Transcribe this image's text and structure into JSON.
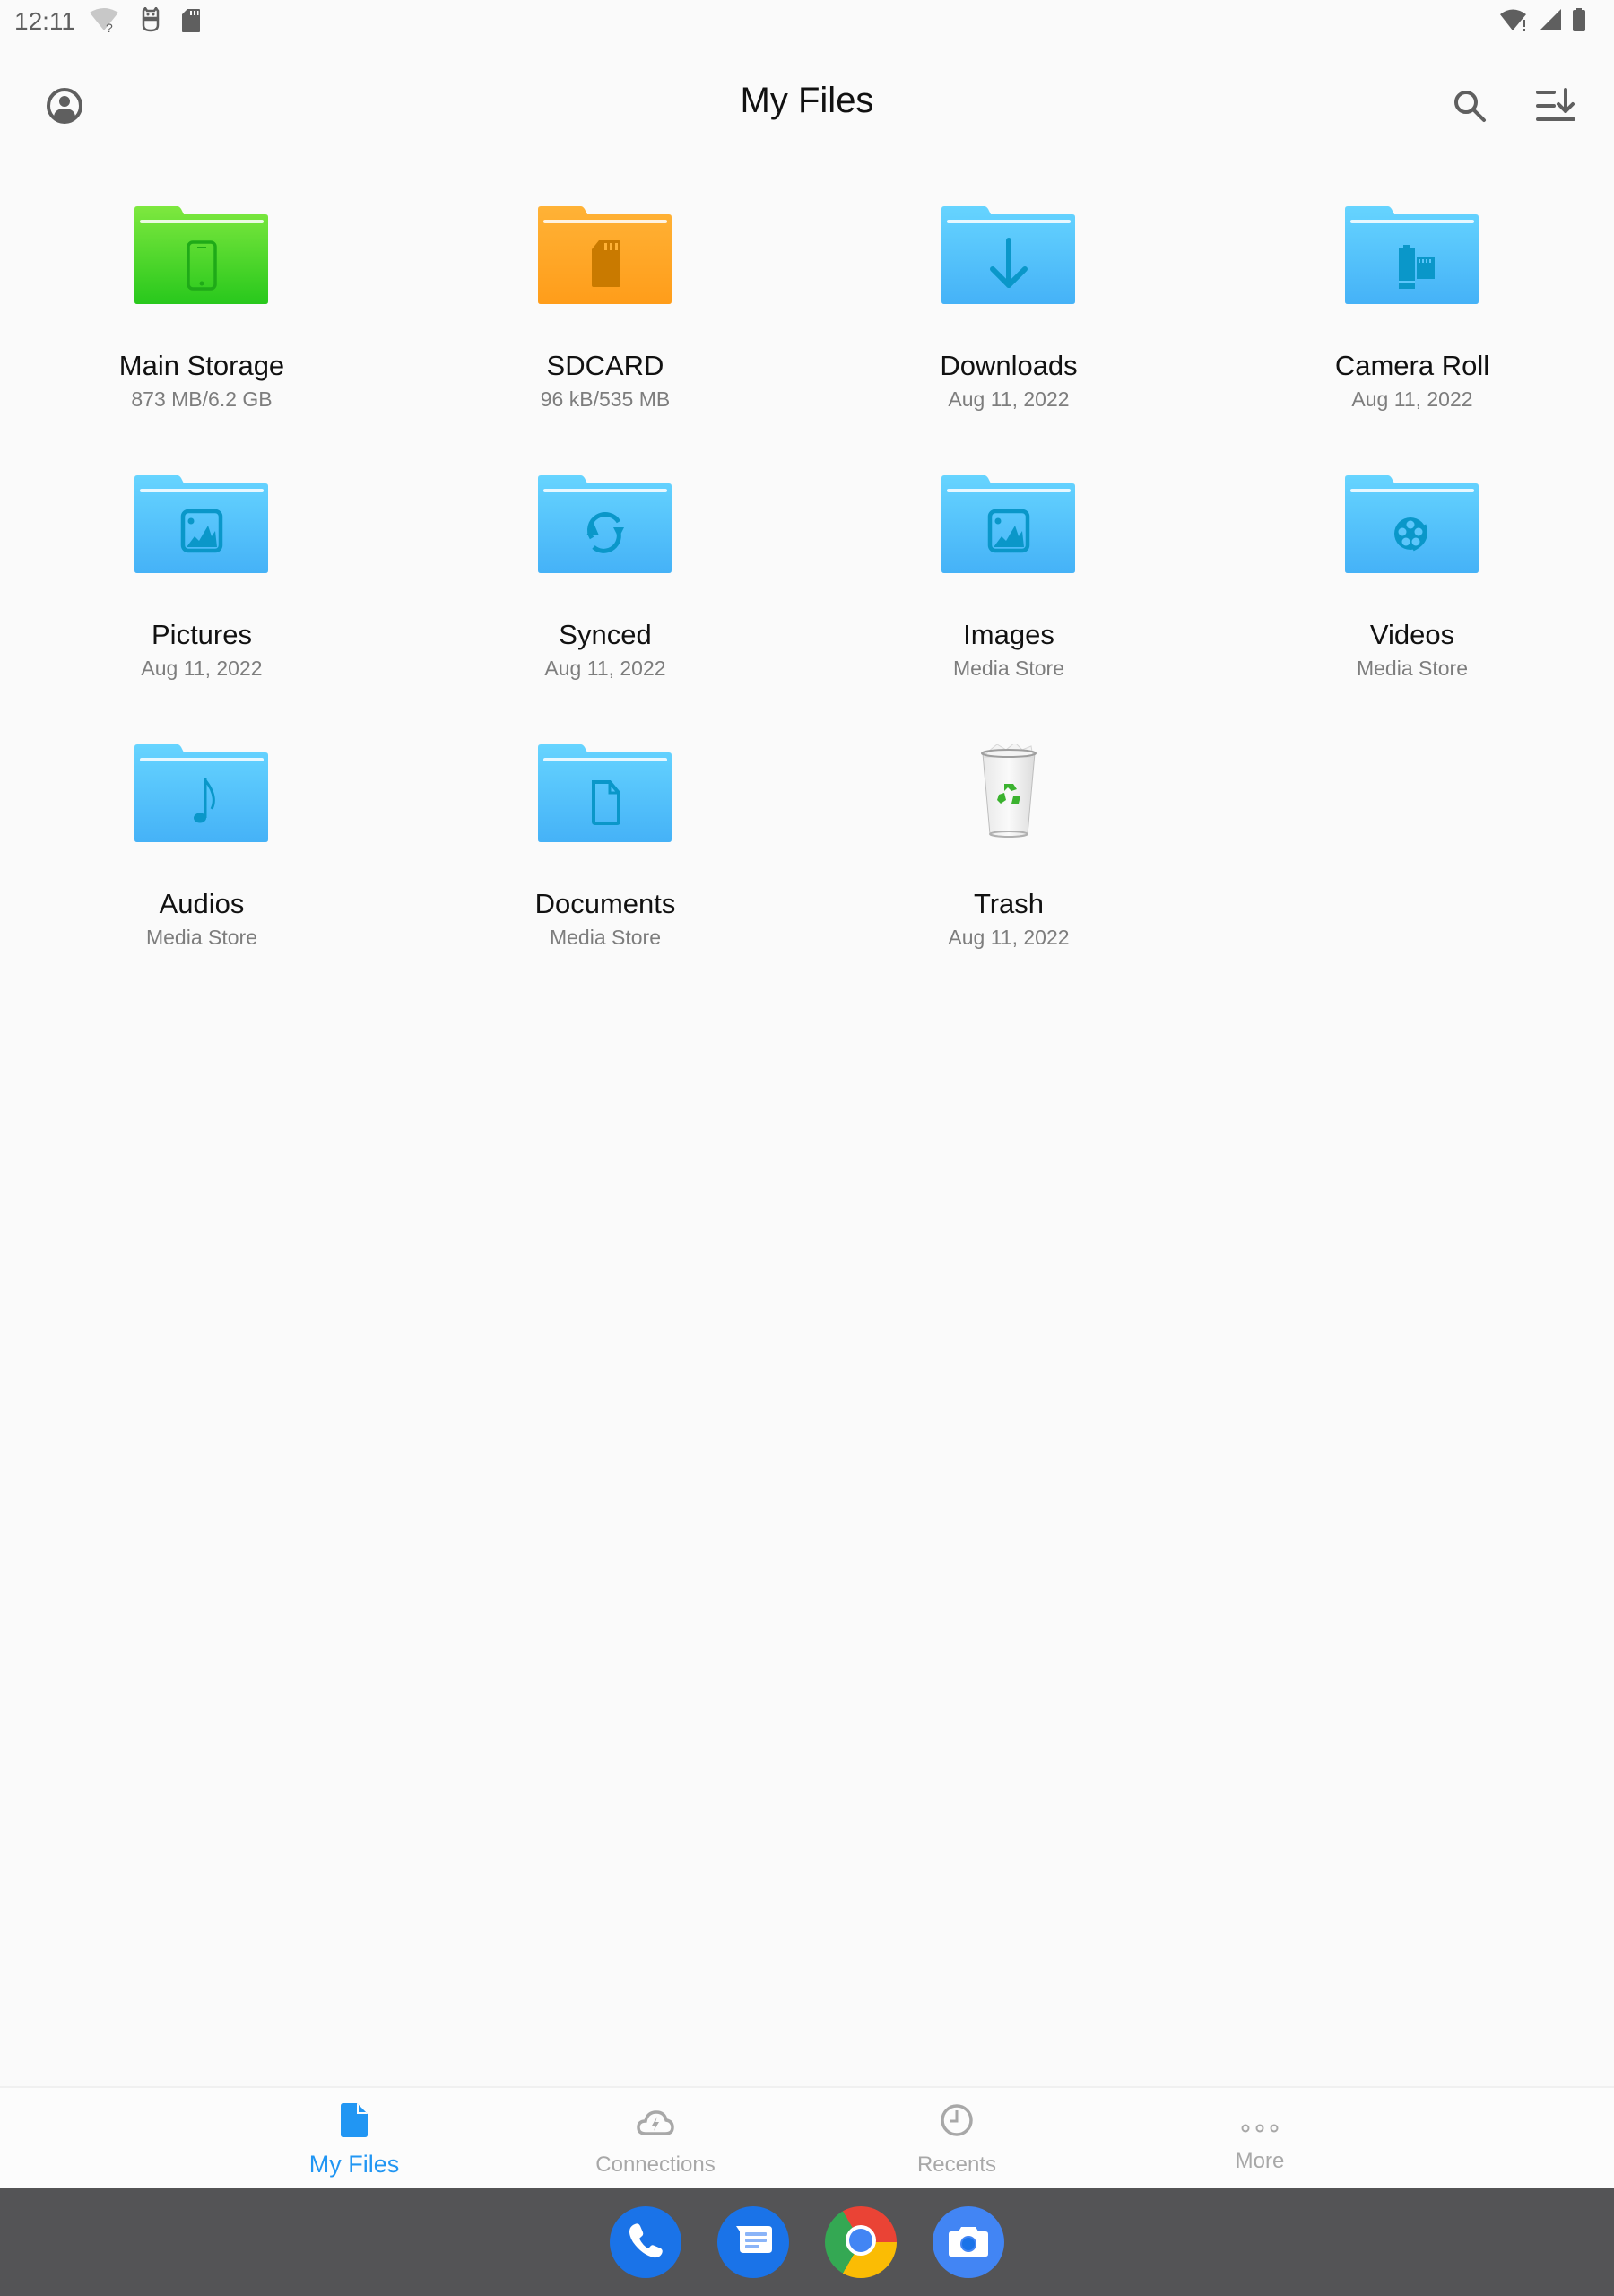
{
  "status_bar": {
    "time": "12:11",
    "left_icons": [
      "wifi-unknown-icon",
      "bot-notification-icon",
      "sd-card-icon"
    ],
    "right_icons": [
      "wifi-alert-icon",
      "cellular-signal-icon",
      "battery-icon"
    ]
  },
  "app_bar": {
    "title": "My Files",
    "account_icon": "account-circle-icon",
    "search_icon": "search-icon",
    "sort_icon": "sort-download-icon"
  },
  "tiles": [
    {
      "label": "Main Storage",
      "sub": "873 MB/6.2 GB",
      "icon": "phone-icon",
      "color": "green"
    },
    {
      "label": "SDCARD",
      "sub": "96 kB/535 MB",
      "icon": "sd-card-icon",
      "color": "orange"
    },
    {
      "label": "Downloads",
      "sub": "Aug 11, 2022",
      "icon": "download-arrow-icon",
      "color": "blue"
    },
    {
      "label": "Camera Roll",
      "sub": "Aug 11, 2022",
      "icon": "film-roll-icon",
      "color": "blue"
    },
    {
      "label": "Pictures",
      "sub": "Aug 11, 2022",
      "icon": "picture-icon",
      "color": "blue"
    },
    {
      "label": "Synced",
      "sub": "Aug 11, 2022",
      "icon": "sync-icon",
      "color": "blue"
    },
    {
      "label": "Images",
      "sub": "Media Store",
      "icon": "picture-icon",
      "color": "blue"
    },
    {
      "label": "Videos",
      "sub": "Media Store",
      "icon": "film-reel-icon",
      "color": "blue"
    },
    {
      "label": "Audios",
      "sub": "Media Store",
      "icon": "music-note-icon",
      "color": "blue"
    },
    {
      "label": "Documents",
      "sub": "Media Store",
      "icon": "document-icon",
      "color": "blue"
    },
    {
      "label": "Trash",
      "sub": "Aug 11, 2022",
      "icon": "recycle-bin-icon",
      "color": "none"
    }
  ],
  "folder_colors": {
    "green": [
      "#7ee83f",
      "#28c81c"
    ],
    "orange": [
      "#ffb236",
      "#ff9d1a"
    ],
    "blue": [
      "#66d4ff",
      "#45b2f7"
    ],
    "glyph_green": "#1faa18",
    "glyph_orange": "#c97a00",
    "glyph_blue": "#0a97c9"
  },
  "bottom_nav": {
    "active_color": "#2196f3",
    "inactive_color": "#a8a8a8",
    "items": [
      {
        "label": "My Files",
        "icon": "file-icon",
        "active": true
      },
      {
        "label": "Connections",
        "icon": "cloud-lightning-icon",
        "active": false
      },
      {
        "label": "Recents",
        "icon": "clock-icon",
        "active": false
      },
      {
        "label": "More",
        "icon": "more-dots-icon",
        "active": false
      }
    ]
  },
  "dock": {
    "apps": [
      {
        "name": "Phone",
        "icon": "phone-app-icon"
      },
      {
        "name": "Messages",
        "icon": "messages-app-icon"
      },
      {
        "name": "Chrome",
        "icon": "chrome-app-icon"
      },
      {
        "name": "Camera",
        "icon": "camera-app-icon"
      }
    ]
  }
}
